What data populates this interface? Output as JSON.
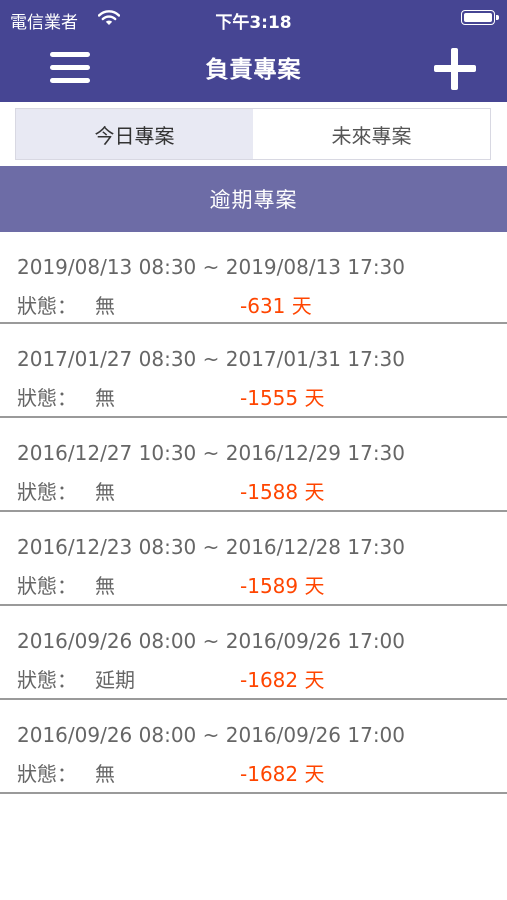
{
  "status_bar": {
    "carrier": "電信業者",
    "time": "下午3:18"
  },
  "header": {
    "title": "負責專案"
  },
  "tabs": [
    {
      "label": "今日專案",
      "active": true
    },
    {
      "label": "未來專案",
      "active": false
    }
  ],
  "section": {
    "title": "逾期專案"
  },
  "status_prefix": "狀態：",
  "items": [
    {
      "range": "2019/08/13  08:30  ~  2019/08/13  17:30",
      "status": "無",
      "days": "-631  天"
    },
    {
      "range": "2017/01/27  08:30  ~  2017/01/31  17:30",
      "status": "無",
      "days": "-1555  天"
    },
    {
      "range": "2016/12/27  10:30  ~  2016/12/29  17:30",
      "status": "無",
      "days": "-1588  天"
    },
    {
      "range": "2016/12/23  08:30  ~  2016/12/28  17:30",
      "status": "無",
      "days": "-1589  天"
    },
    {
      "range": "2016/09/26  08:00  ~  2016/09/26  17:00",
      "status": "延期",
      "days": "-1682  天"
    },
    {
      "range": "2016/09/26  08:00  ~  2016/09/26  17:00",
      "status": "無",
      "days": "-1682  天"
    }
  ],
  "colors": {
    "header": "#464593",
    "section": "#6d6ca6",
    "days": "#ff4500"
  }
}
